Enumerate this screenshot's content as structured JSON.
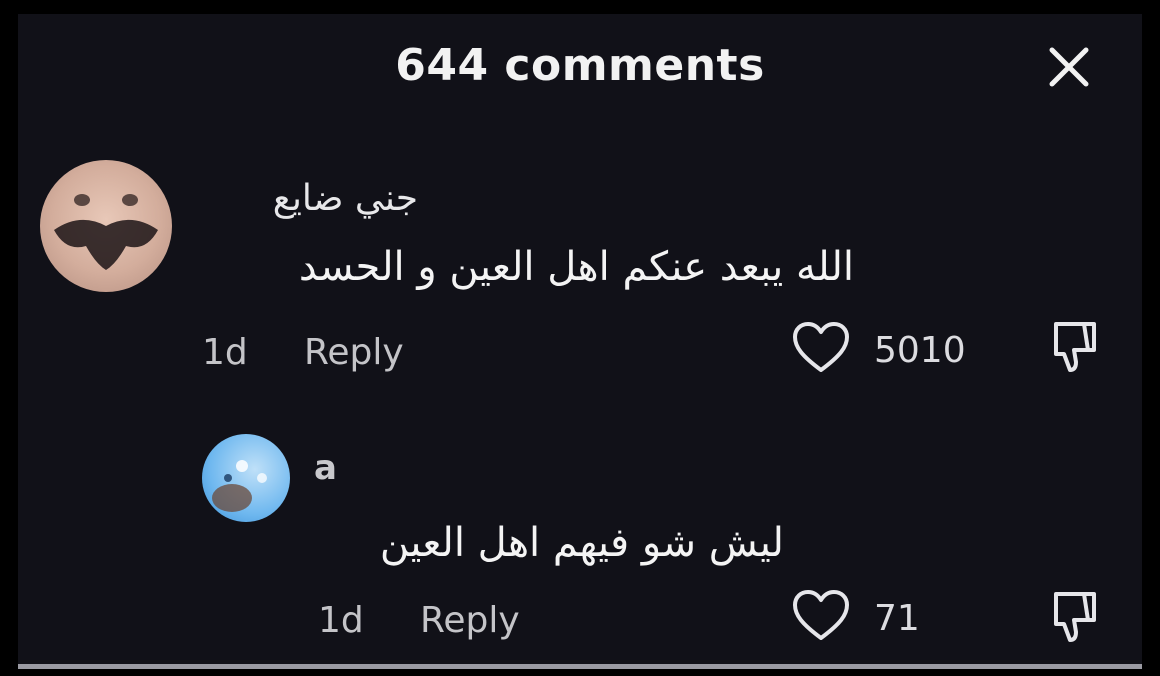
{
  "header": {
    "title": "644 comments",
    "close_icon": "close-icon"
  },
  "comments": [
    {
      "username": "جني ضايع",
      "text": "الله يبعد عنكم اهل العين و الحسد",
      "time": "1d",
      "reply_label": "Reply",
      "likes": "5010",
      "avatar": "avatar-image"
    },
    {
      "username": "a",
      "text": "ليش شو فيهم اهل العين",
      "time": "1d",
      "reply_label": "Reply",
      "likes": "71",
      "avatar": "avatar-image"
    }
  ],
  "colors": {
    "background": "#111118",
    "text": "#f4f4f4",
    "muted": "#c4c4c8"
  }
}
